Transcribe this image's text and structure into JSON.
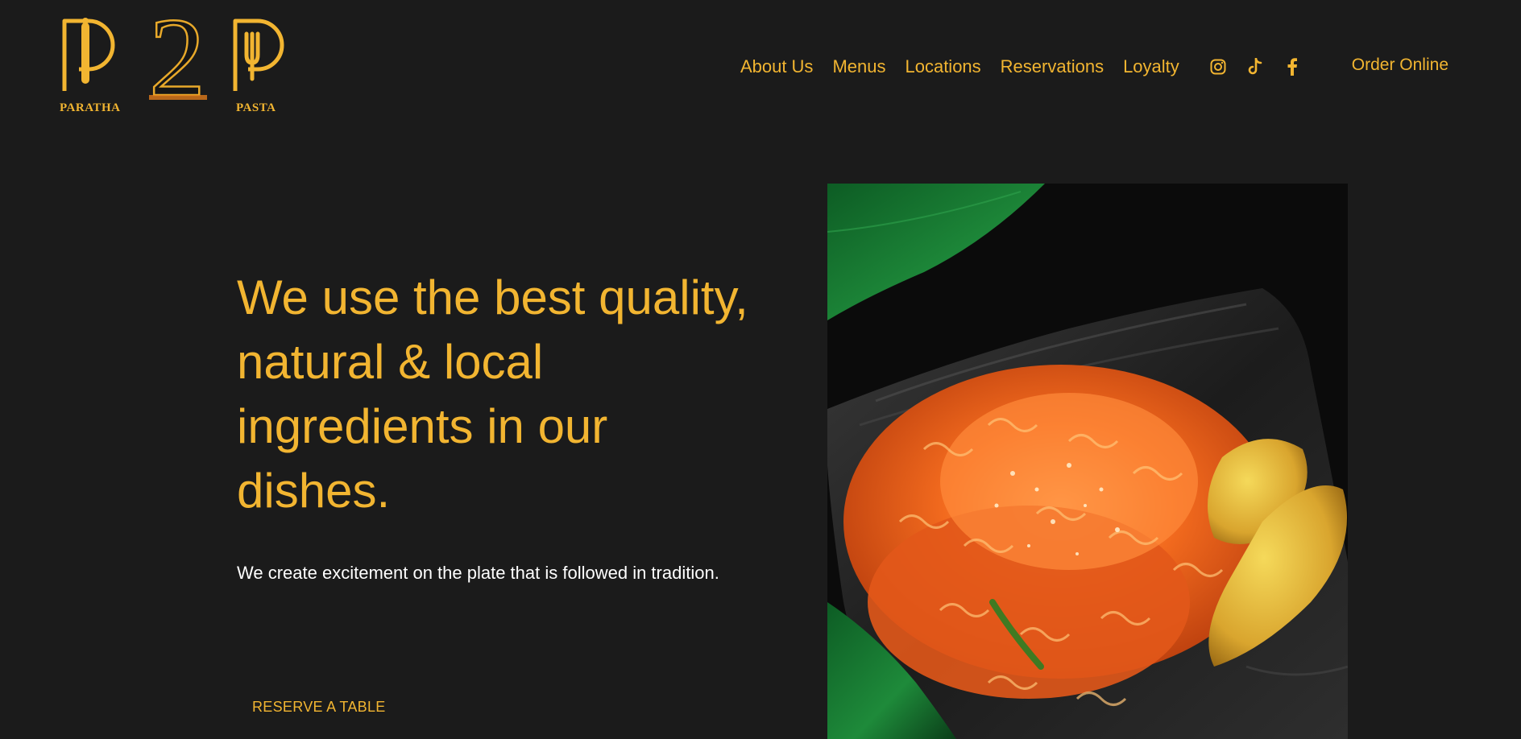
{
  "logo": {
    "left_word": "PARATHA",
    "center_char": "2",
    "right_word": "PASTA"
  },
  "nav": {
    "items": [
      {
        "label": "About Us"
      },
      {
        "label": "Menus"
      },
      {
        "label": "Locations"
      },
      {
        "label": "Reservations"
      },
      {
        "label": "Loyalty"
      }
    ],
    "social": [
      {
        "icon": "instagram-icon"
      },
      {
        "icon": "tiktok-icon"
      },
      {
        "icon": "facebook-icon"
      }
    ],
    "order_label": "Order Online"
  },
  "hero": {
    "title": "We use the best quality, natural & local ingredients in our dishes.",
    "subtitle": "We create excitement on the plate that is followed in tradition.",
    "cta_label": "RESERVE A TABLE"
  },
  "colors": {
    "background": "#1b1b1b",
    "accent": "#f2b531",
    "text": "#ffffff"
  }
}
